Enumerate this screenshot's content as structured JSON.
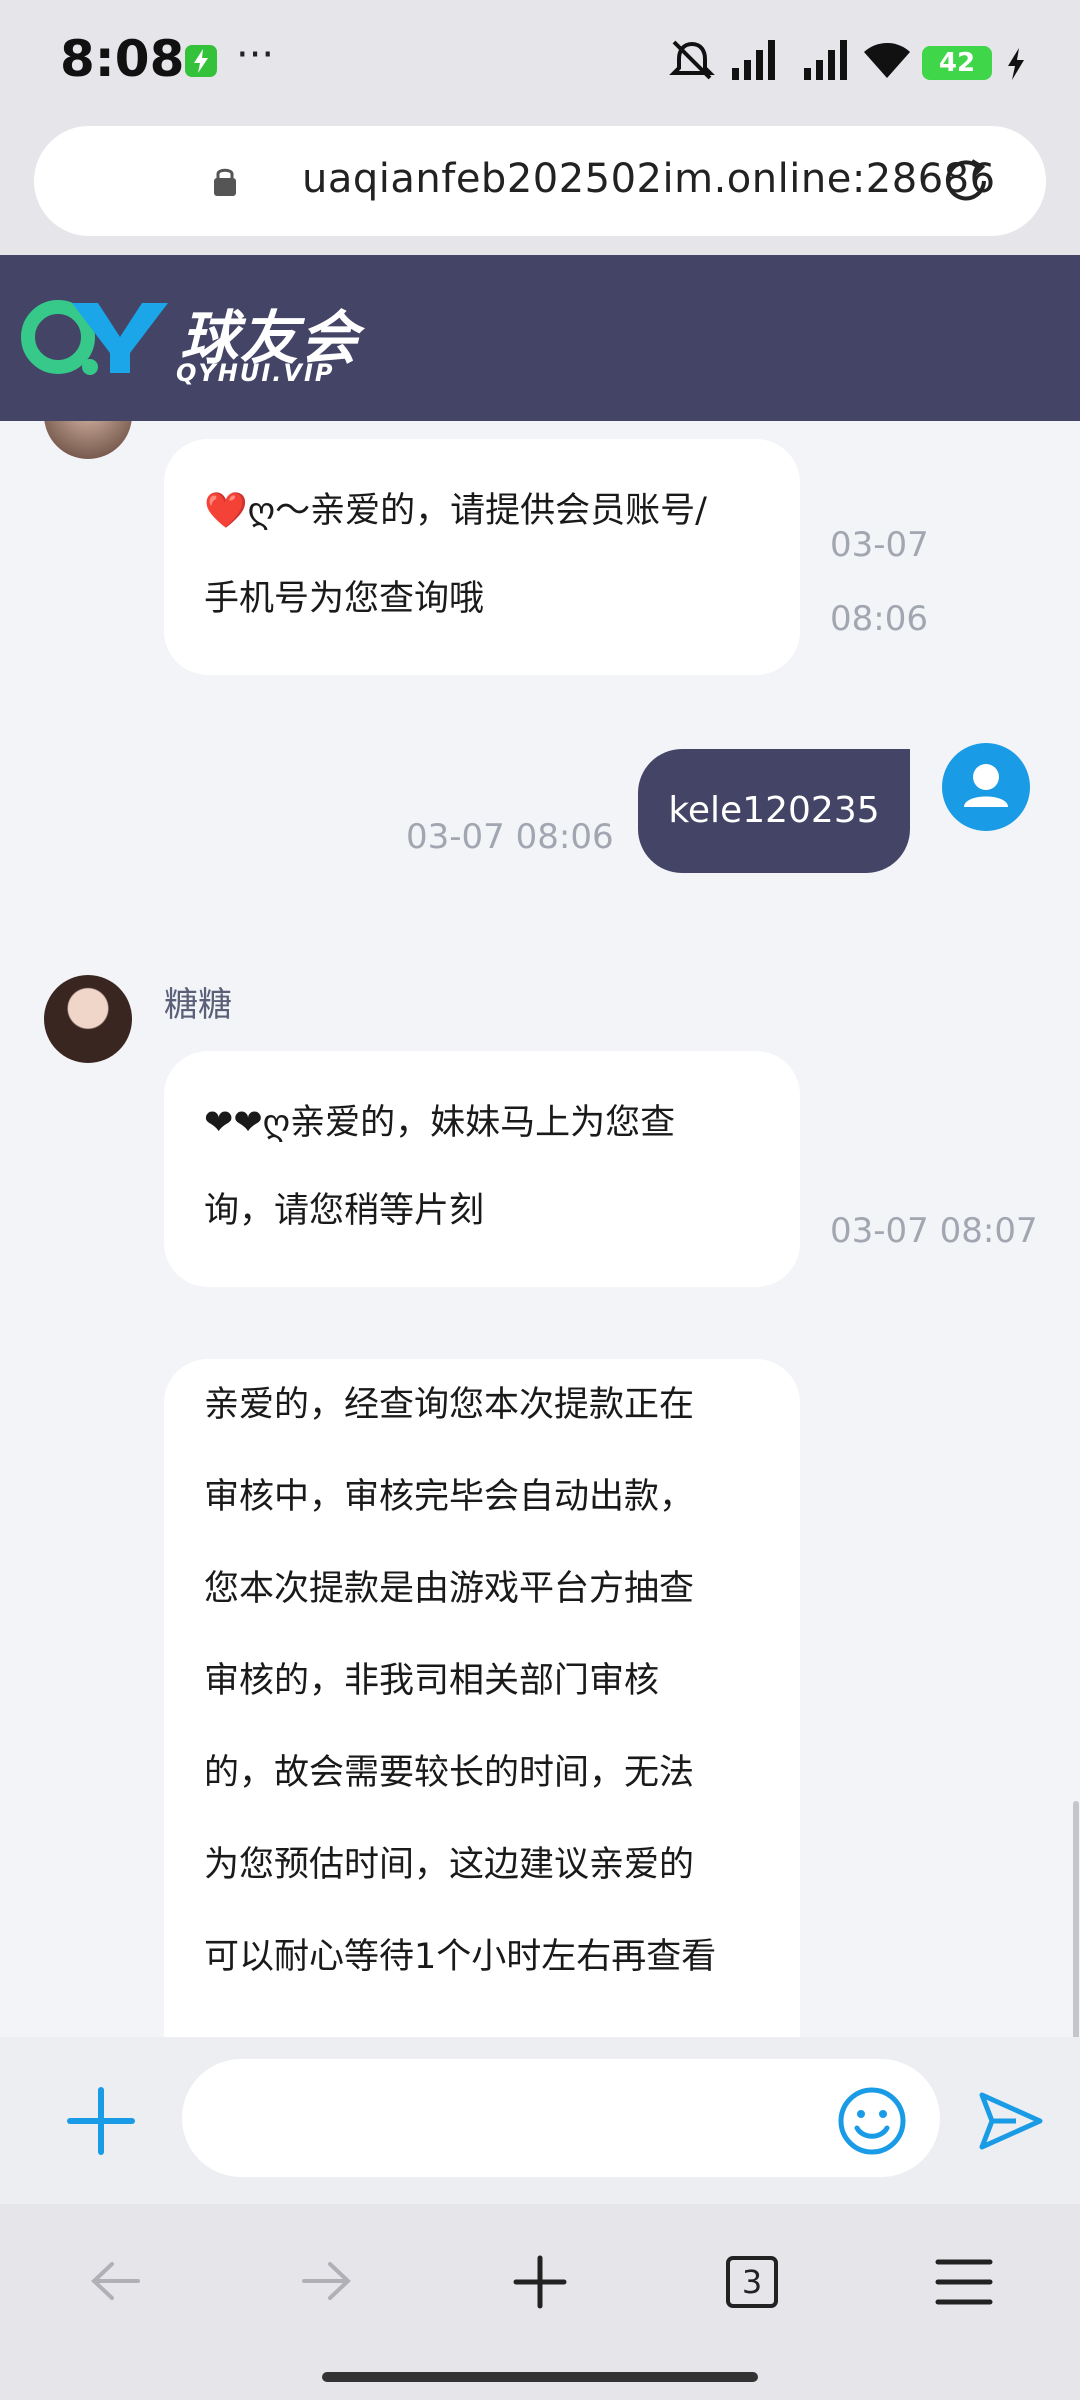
{
  "status_bar": {
    "time": "8:08",
    "dots": "···",
    "battery": "42"
  },
  "browser": {
    "url": "uaqianfeb202502im.online:28686"
  },
  "header": {
    "logo_letters": "QY",
    "brand_cn": "球友会",
    "brand_en": "QYHUI.VIP"
  },
  "messages": [
    {
      "side": "agent",
      "text_lines": [
        "❤️ღ～亲爱的，请提供会员账号/",
        "手机号为您查询哦"
      ],
      "time_lines": [
        "03-07",
        "08:06"
      ]
    },
    {
      "side": "user",
      "text": "kele120235",
      "time": "03-07 08:06"
    },
    {
      "side": "agent",
      "name": "糖糖",
      "text_lines": [
        "❤❤ღ亲爱的，妹妹马上为您查",
        "询，请您稍等片刻"
      ],
      "time": "03-07 08:07"
    },
    {
      "side": "agent",
      "text_lines": [
        "亲爱的，经查询您本次提款正在",
        "审核中，审核完毕会自动出款，",
        "您本次提款是由游戏平台方抽查",
        "审核的，非我司相关部门审核",
        "的，故会需要较长的时间，无法",
        "为您预估时间，这边建议亲爱的",
        "可以耐心等待1个小时左右再查看"
      ]
    }
  ],
  "input": {
    "placeholder": ""
  },
  "nav": {
    "tab_count": "3"
  },
  "colors": {
    "header_bg": "#434466",
    "user_bubble": "#434466",
    "accent_blue": "#1a9be6",
    "logo_green": "#37c98a"
  }
}
